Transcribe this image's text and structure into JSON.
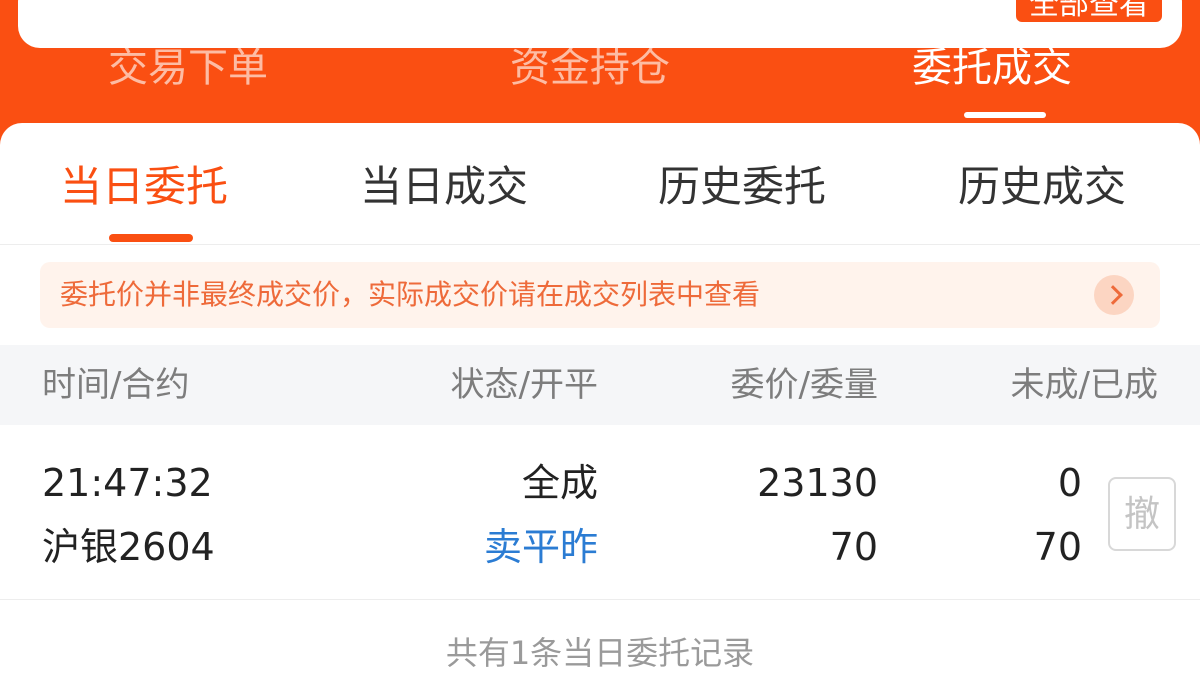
{
  "top_card": {
    "view_all_label": "全部查看"
  },
  "main_tabs": [
    {
      "label": "交易下单"
    },
    {
      "label": "资金持仓"
    },
    {
      "label": "委托成交"
    }
  ],
  "sub_tabs": [
    {
      "label": "当日委托"
    },
    {
      "label": "当日成交"
    },
    {
      "label": "历史委托"
    },
    {
      "label": "历史成交"
    }
  ],
  "notice": {
    "text": "委托价并非最终成交价，实际成交价请在成交列表中查看"
  },
  "table": {
    "headers": [
      "时间/合约",
      "状态/开平",
      "委价/委量",
      "未成/已成"
    ],
    "rows": [
      {
        "time": "21:47:32",
        "contract": "沪银2604",
        "status": "全成",
        "open_close": "卖平昨",
        "order_price": "23130",
        "order_qty": "70",
        "unfilled": "0",
        "filled": "70",
        "cancel_label": "撤"
      }
    ]
  },
  "footer": {
    "text": "共有1条当日委托记录"
  },
  "colors": {
    "brand": "#fa4f12",
    "blue": "#2b7cd3",
    "notice_bg": "#fff3ec"
  }
}
